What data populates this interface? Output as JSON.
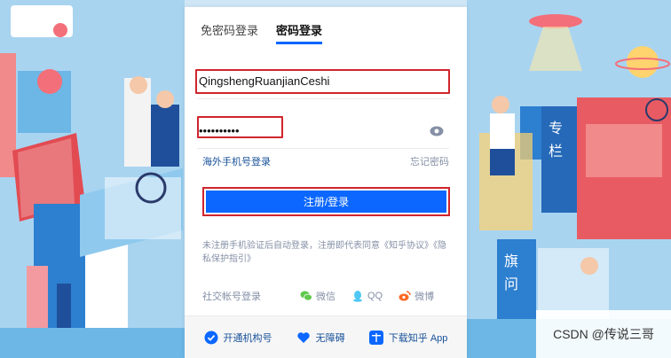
{
  "tabs": {
    "sms_login": "免密码登录",
    "password_login": "密码登录"
  },
  "form": {
    "username_value": "QingshengRuanjianCeshi",
    "password_value": "1234567890",
    "overseas_link": "海外手机号登录",
    "forgot_link": "忘记密码",
    "submit_label": "注册/登录"
  },
  "agreement": {
    "text": "未注册手机验证后自动登录，注册即代表同意《知乎协议》《隐私保护指引》"
  },
  "social": {
    "label": "社交帐号登录",
    "wechat": "微信",
    "qq": "QQ",
    "weibo": "微博"
  },
  "footer": {
    "org_account": "开通机构号",
    "accessibility": "无障碍",
    "download": "下载知乎 App"
  },
  "watermark": "CSDN @传说三哥",
  "colors": {
    "accent": "#0b67ff",
    "highlight": "#d0252d"
  }
}
